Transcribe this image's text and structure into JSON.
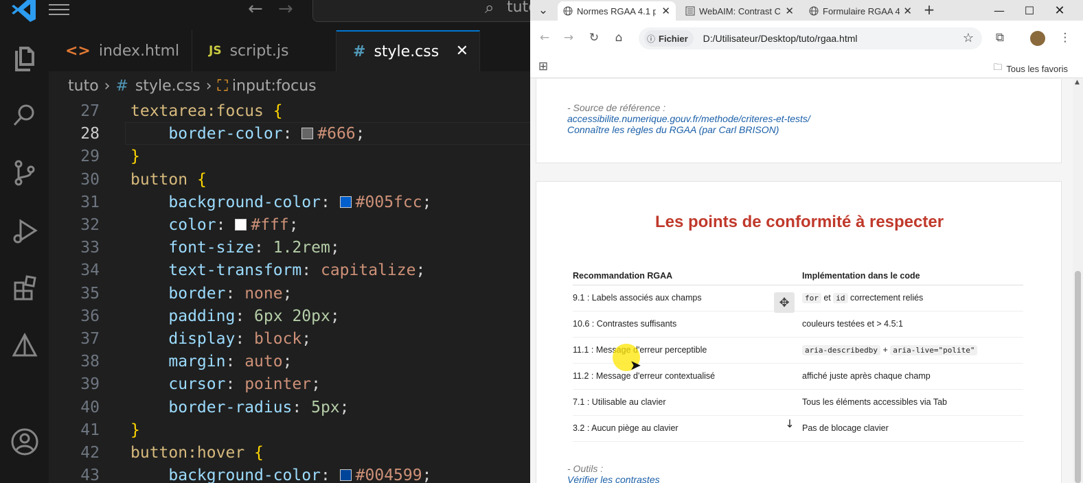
{
  "vscode": {
    "tabs": [
      {
        "icon": "<>",
        "label": "index.html",
        "active": false
      },
      {
        "icon": "JS",
        "label": "script.js",
        "active": false
      },
      {
        "icon": "#",
        "label": "style.css",
        "active": true,
        "close": "✕"
      }
    ],
    "breadcrumb": {
      "folder": "tuto",
      "file_icon": "#",
      "file": "style.css",
      "symbol": "input:focus"
    },
    "search_partial": "tuto",
    "lines": [
      {
        "n": "27",
        "code": "textarea:focus {"
      },
      {
        "n": "28",
        "code": "    border-color: #666;"
      },
      {
        "n": "29",
        "code": "}"
      },
      {
        "n": "30",
        "code": "button {"
      },
      {
        "n": "31",
        "code": "    background-color: #005fcc;"
      },
      {
        "n": "32",
        "code": "    color: #fff;"
      },
      {
        "n": "33",
        "code": "    font-size: 1.2rem;"
      },
      {
        "n": "34",
        "code": "    text-transform: capitalize;"
      },
      {
        "n": "35",
        "code": "    border: none;"
      },
      {
        "n": "36",
        "code": "    padding: 6px 20px;"
      },
      {
        "n": "37",
        "code": "    display: block;"
      },
      {
        "n": "38",
        "code": "    margin: auto;"
      },
      {
        "n": "39",
        "code": "    cursor: pointer;"
      },
      {
        "n": "40",
        "code": "    border-radius: 5px;"
      },
      {
        "n": "41",
        "code": "}"
      },
      {
        "n": "42",
        "code": "button:hover {"
      },
      {
        "n": "43",
        "code": "    background-color: #004599;"
      }
    ],
    "swatch_colors": {
      "c666": "#666666",
      "c005fcc": "#005fcc",
      "cfff": "#ffffff",
      "c004599": "#004599"
    }
  },
  "browser": {
    "tabs": [
      {
        "label": "Normes RGAA 4.1 p",
        "close": "✕"
      },
      {
        "label": "WebAIM: Contrast C",
        "close": "✕"
      },
      {
        "label": "Formulaire RGAA 4.",
        "close": "✕"
      }
    ],
    "new_tab": "+",
    "chip_label": "Fichier",
    "url": "D:/Utilisateur/Desktop/tuto/rgaa.html",
    "bookmarks_all": "Tous les favoris",
    "source": {
      "label": "- Source de référence :",
      "link1": "accessibilite.numerique.gouv.fr/methode/criteres-et-tests/",
      "link2": "Connaître les règles du RGAA (par Carl BRISON)"
    },
    "heading": "Les points de conformité à respecter",
    "table": {
      "headers": [
        "Recommandation RGAA",
        "Implémentation dans le code"
      ],
      "rows": [
        {
          "reco": "9.1 : Labels associés aux champs",
          "code1": "for",
          "mid": "et",
          "code2": "id",
          "impl": "correctement reliés"
        },
        {
          "reco": "10.6 : Contrastes suffisants",
          "impl": "couleurs testées et > 4.5:1"
        },
        {
          "reco": "11.1 : Message d'erreur perceptible",
          "code1": "aria-describedby",
          "mid": "+",
          "code2": "aria-live=\"polite\"",
          "impl": ""
        },
        {
          "reco": "11.2 : Message d'erreur contextualisé",
          "impl": "affiché juste après chaque champ"
        },
        {
          "reco": "7.1 : Utilisable au clavier",
          "impl": "Tous les éléments accessibles via Tab"
        },
        {
          "reco": "3.2 : Aucun piège au clavier",
          "impl": "Pas de blocage clavier"
        }
      ]
    },
    "tools": {
      "label": "- Outils :",
      "link": "Vérifier les contrastes"
    }
  },
  "colors": {
    "accent": "#0078d4",
    "heading_red": "#c0392b",
    "link_blue": "#1a5fa8"
  }
}
